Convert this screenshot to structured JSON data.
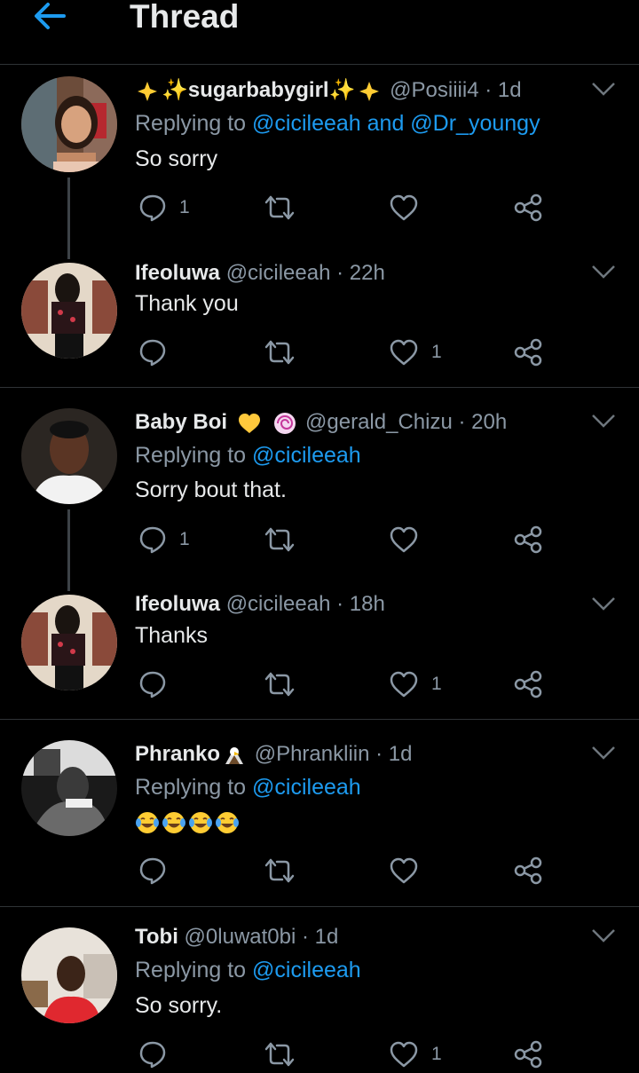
{
  "header": {
    "title": "Thread"
  },
  "tweets": [
    {
      "name": "✨sugarbabygirl✨",
      "handle": "@Posiiii4",
      "time": "· 1d",
      "replying_prefix": "Replying to",
      "replying_mentions": "@cicileeah and @Dr_youngy",
      "text": "So sorry",
      "reply_count": "1",
      "like_count": ""
    },
    {
      "name": "Ifeoluwa",
      "handle": "@cicileeah",
      "time": "· 22h",
      "text": "Thank you",
      "reply_count": "",
      "like_count": "1"
    },
    {
      "name": "Baby Boi",
      "handle": "@gerald_Chizu",
      "time": "· 20h",
      "replying_prefix": "Replying to",
      "replying_mentions": "@cicileeah",
      "text": "Sorry bout that.",
      "reply_count": "1",
      "like_count": ""
    },
    {
      "name": "Ifeoluwa",
      "handle": "@cicileeah",
      "time": "· 18h",
      "text": "Thanks",
      "reply_count": "",
      "like_count": "1"
    },
    {
      "name": "Phranko",
      "handle": "@Phrankliin",
      "time": "· 1d",
      "replying_prefix": "Replying to",
      "replying_mentions": "@cicileeah",
      "text": "",
      "reply_count": "",
      "like_count": ""
    },
    {
      "name": "Tobi",
      "handle": "@0luwat0bi",
      "time": "· 1d",
      "replying_prefix": "Replying to",
      "replying_mentions": "@cicileeah",
      "text": "So sorry.",
      "reply_count": "",
      "like_count": "1"
    }
  ],
  "colors": {
    "accent": "#1d9bf0",
    "muted": "#8b98a5",
    "background": "#000000",
    "heart_emoji": "#ffc93c"
  },
  "icons": [
    "back-arrow-icon",
    "chevron-down-icon",
    "reply-icon",
    "retweet-icon",
    "like-icon",
    "share-icon",
    "heart-emoji-icon",
    "sparkles-emoji-icon",
    "lollipop-emoji-icon",
    "eagle-emoji-icon",
    "tears-of-joy-emoji-icon"
  ]
}
